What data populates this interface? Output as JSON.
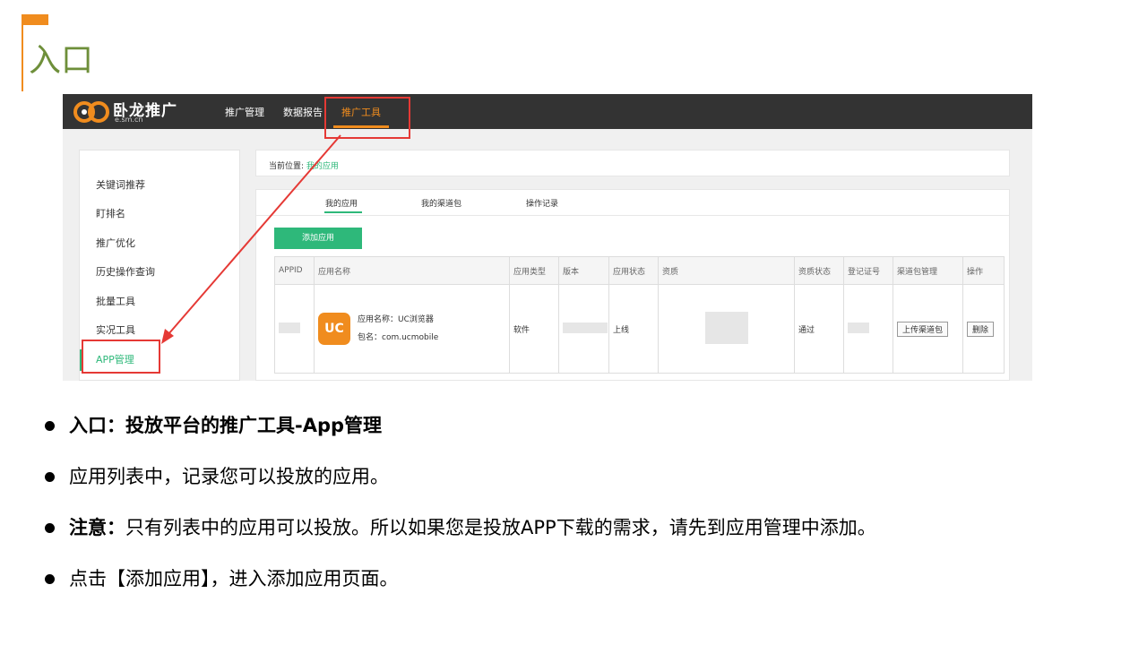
{
  "slide": {
    "title": "入口"
  },
  "app": {
    "logo_text": "卧龙推广",
    "logo_sub": "e.sm.cn",
    "nav": [
      {
        "label": "推广管理"
      },
      {
        "label": "数据报告"
      },
      {
        "label": "推广工具"
      }
    ]
  },
  "sidebar": {
    "items": [
      {
        "label": "关键词推荐"
      },
      {
        "label": "盯排名"
      },
      {
        "label": "推广优化"
      },
      {
        "label": "历史操作查询"
      },
      {
        "label": "批量工具"
      },
      {
        "label": "实况工具"
      },
      {
        "label": "APP管理"
      }
    ]
  },
  "breadcrumb": {
    "prefix": "当前位置:",
    "current": "我的应用"
  },
  "tabs": [
    {
      "label": "我的应用"
    },
    {
      "label": "我的渠道包"
    },
    {
      "label": "操作记录"
    }
  ],
  "add_button": "添加应用",
  "table": {
    "headers": [
      "APPID",
      "应用名称",
      "应用类型",
      "版本",
      "应用状态",
      "资质",
      "资质状态",
      "登记证号",
      "渠道包管理",
      "操作"
    ],
    "rows": [
      {
        "app_name": "应用名称：UC浏览器",
        "package": "包名：com.ucmobile",
        "type": "软件",
        "status": "上线",
        "qual_status": "通过",
        "upload_btn": "上传渠道包",
        "delete_btn": "删除"
      }
    ]
  },
  "icons": {
    "app_icon": "uc-browser-icon",
    "logo": "wolong-logo-icon"
  },
  "colors": {
    "accent_orange": "#F08C1E",
    "title_green": "#6E8F3A",
    "brand_green": "#2EB87A",
    "highlight_red": "#E53935"
  },
  "bullets": [
    {
      "bold": "入口：投放平台的推广工具-App管理",
      "text": ""
    },
    {
      "bold": "",
      "text": "应用列表中，记录您可以投放的应用。"
    },
    {
      "bold": "注意：",
      "text": "只有列表中的应用可以投放。所以如果您是投放APP下载的需求，请先到应用管理中添加。"
    },
    {
      "bold": "",
      "text": "点击【添加应用】，进入添加应用页面。"
    }
  ]
}
